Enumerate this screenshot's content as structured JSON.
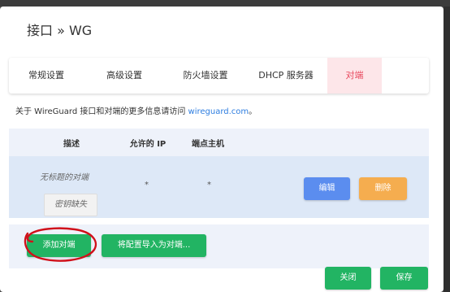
{
  "modal": {
    "title": "接口 » WG"
  },
  "tabs": [
    {
      "label": "常规设置",
      "active": false
    },
    {
      "label": "高级设置",
      "active": false
    },
    {
      "label": "防火墙设置",
      "active": false
    },
    {
      "label": "DHCP 服务器",
      "active": false
    },
    {
      "label": "对端",
      "active": true
    }
  ],
  "info": {
    "prefix": "关于 WireGuard 接口和对端的更多信息请访问 ",
    "link_text": "wireguard.com",
    "suffix": "。"
  },
  "peers_table": {
    "headers": [
      "描述",
      "允许的 IP",
      "端点主机"
    ],
    "rows": [
      {
        "description": "无标题的对端",
        "allowed_ips": "*",
        "endpoint_host": "*",
        "missing_key_label": "密钥缺失",
        "edit_label": "编辑",
        "delete_label": "删除"
      }
    ]
  },
  "actions": {
    "add_peer_label": "添加对端",
    "import_config_label": "将配置导入为对端...",
    "close_label": "关闭",
    "save_label": "保存"
  },
  "colors": {
    "green": "#22b463",
    "edit_blue": "#5b8def",
    "delete_orange": "#f5ad4f",
    "active_tab_text": "#e84a5f",
    "annotation_red": "#d0101a"
  },
  "icons": {
    "annotation": "red-hand-drawn-circle"
  }
}
